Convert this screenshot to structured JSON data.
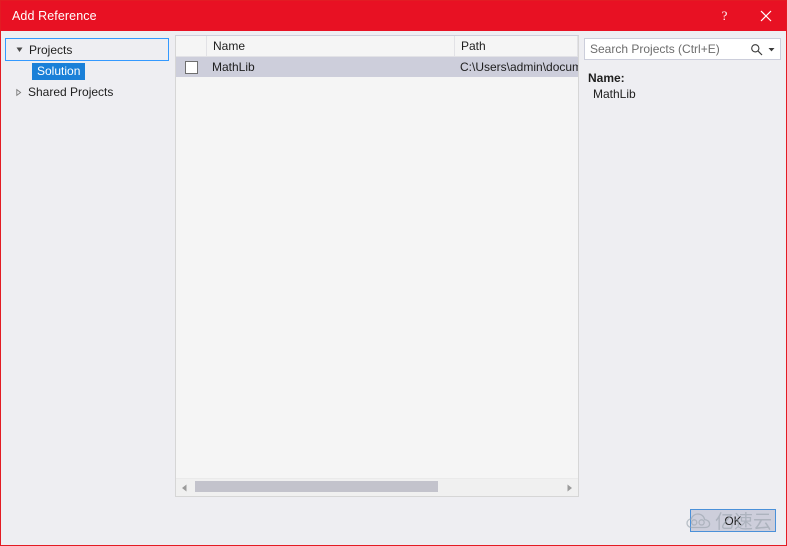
{
  "window": {
    "title": "Add Reference",
    "help_button": "?",
    "close_button": "✕",
    "accent_color": "#e81123",
    "border_color": "#e31b23"
  },
  "sidebar": {
    "nodes": [
      {
        "label": "Projects",
        "expanded": true,
        "selected_child": "Solution"
      },
      {
        "label": "Shared Projects",
        "expanded": false
      }
    ],
    "children": [
      {
        "label": "Solution",
        "selected": true,
        "highlight_color": "#1a80d8"
      }
    ]
  },
  "search": {
    "placeholder": "Search Projects (Ctrl+E)",
    "value": "",
    "icon": "search-icon",
    "caret": "▾"
  },
  "list": {
    "columns": [
      {
        "key": "check",
        "label": ""
      },
      {
        "key": "name",
        "label": "Name"
      },
      {
        "key": "path",
        "label": "Path"
      }
    ],
    "rows": [
      {
        "checked": false,
        "name": "MathLib",
        "path": "C:\\Users\\admin\\documen",
        "selected": true,
        "selected_color": "#cdcedb"
      }
    ],
    "hscroll": {
      "thumb_percent": 66,
      "left_arrow": "◀",
      "right_arrow": "▶"
    }
  },
  "details": {
    "name_label": "Name:",
    "name_value": "MathLib"
  },
  "footer": {
    "ok_label": "OK"
  },
  "watermark": {
    "text": "亿速云",
    "icon": "cloud-logo-icon",
    "color": "#9aa4ad"
  }
}
